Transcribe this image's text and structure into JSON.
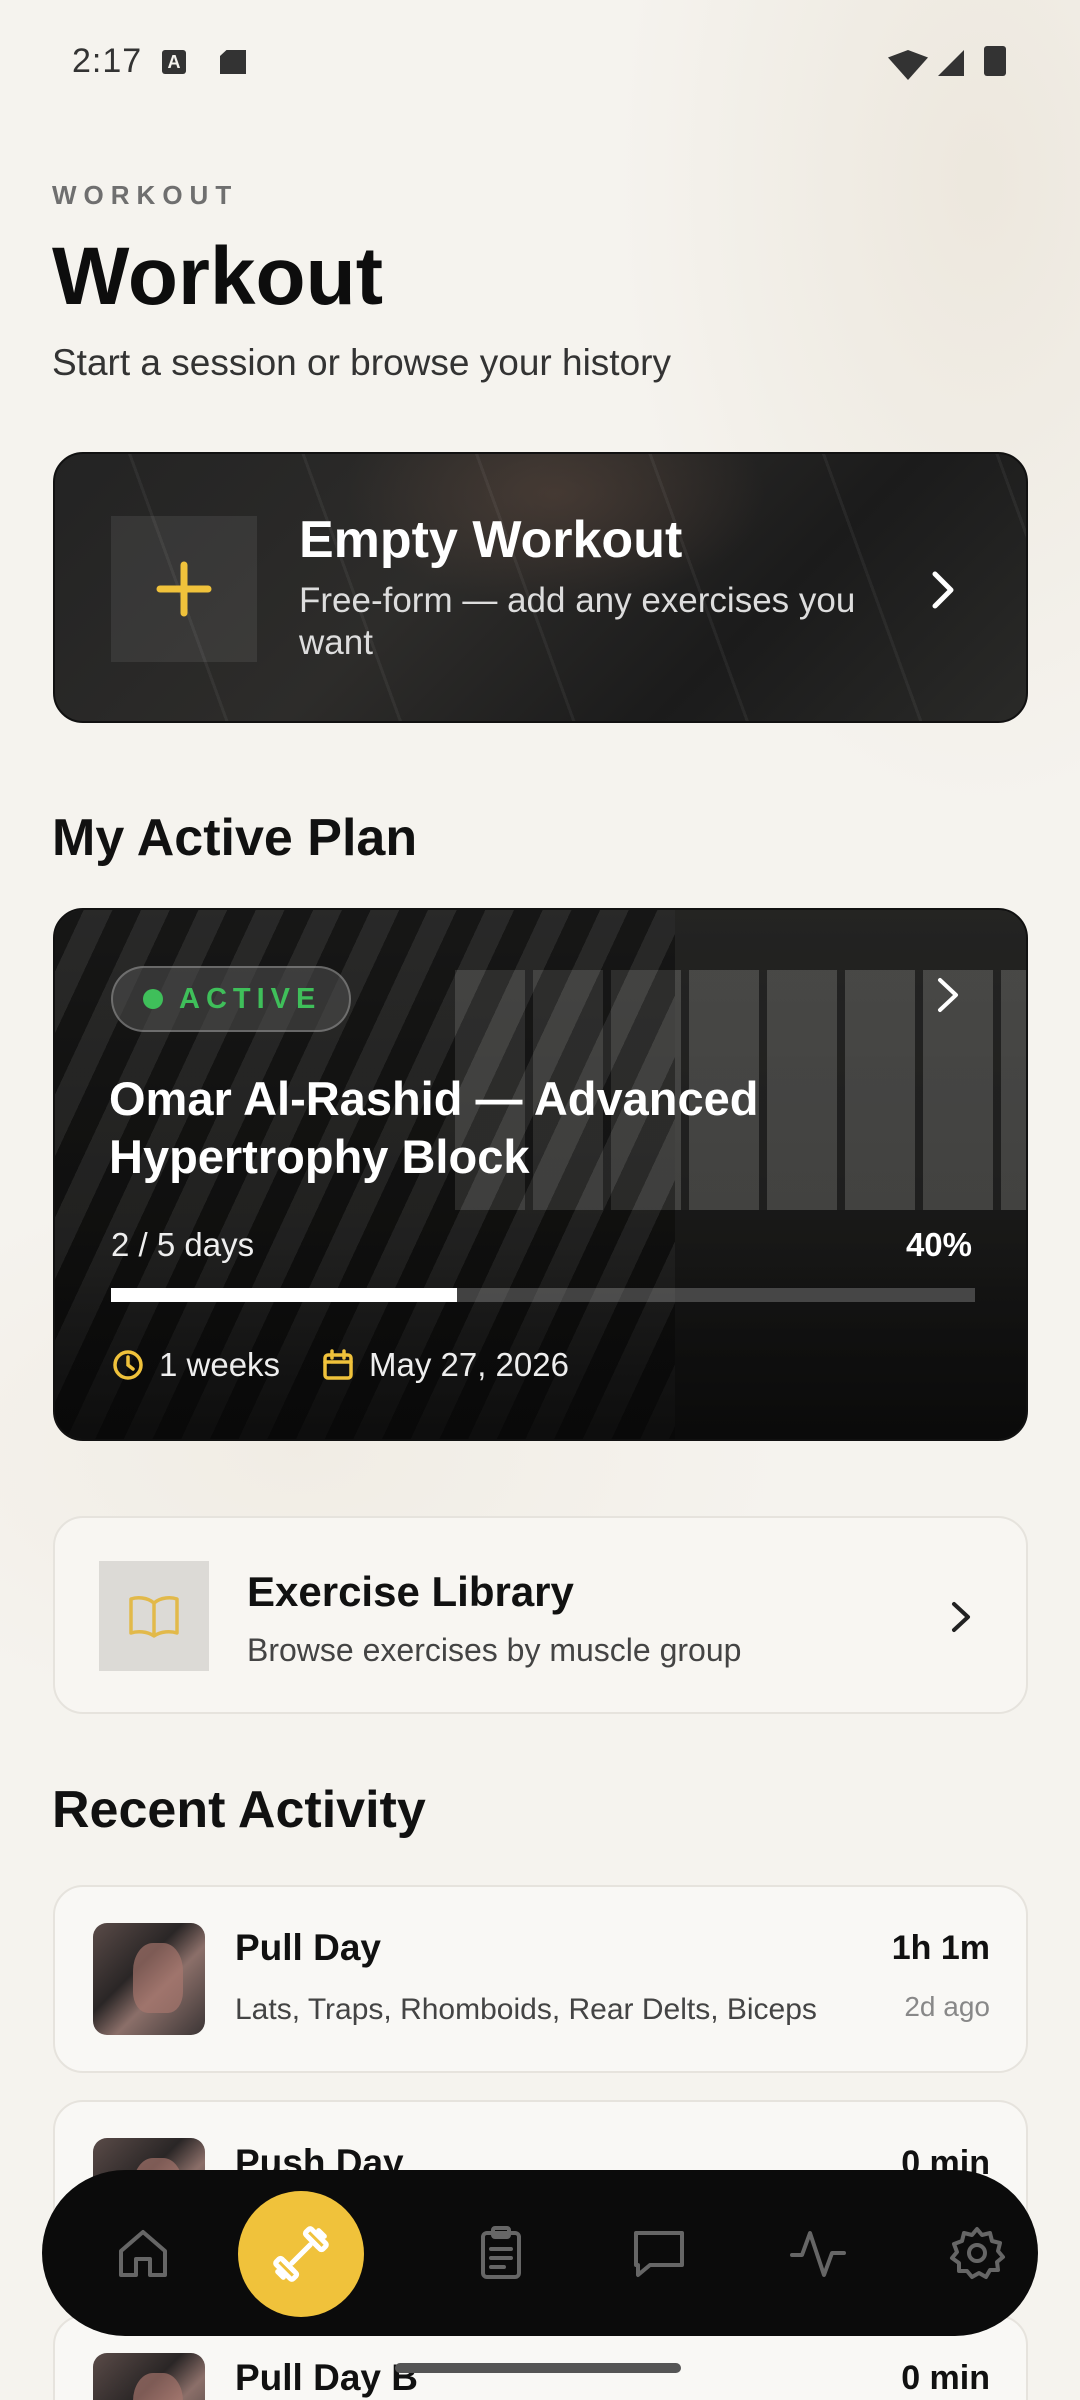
{
  "status_bar": {
    "time": "2:17",
    "a_icon_letter": "A"
  },
  "header": {
    "eyebrow": "WORKOUT",
    "title": "Workout",
    "subtitle": "Start a session or browse your history"
  },
  "empty_workout": {
    "title": "Empty Workout",
    "description": "Free-form — add any exercises you want",
    "icon": "plus-icon"
  },
  "active_plan": {
    "section_title": "My Active Plan",
    "badge": "ACTIVE",
    "title": "Omar Al-Rashid — Advanced Hypertrophy Block",
    "days": "2 / 5 days",
    "percent": "40%",
    "progress_fraction": 0.4,
    "duration": "1 weeks",
    "date": "May 27, 2026"
  },
  "library": {
    "title": "Exercise Library",
    "description": "Browse exercises by muscle group",
    "icon": "book-icon"
  },
  "recent": {
    "section_title": "Recent Activity",
    "items": [
      {
        "title": "Pull Day",
        "muscles": "Lats, Traps, Rhomboids, Rear Delts, Biceps",
        "duration": "1h 1m",
        "ago": "2d ago"
      },
      {
        "title": "Push Day",
        "muscles": "",
        "duration": "0 min",
        "ago": ""
      },
      {
        "title": "Pull Day B",
        "muscles": "",
        "duration": "0 min",
        "ago": ""
      }
    ]
  },
  "nav": {
    "items": [
      "home-icon",
      "dumbbell-icon",
      "clipboard-icon",
      "chat-icon",
      "activity-icon",
      "settings-icon"
    ],
    "active": "dumbbell-icon"
  },
  "colors": {
    "accent": "#f0c23b",
    "active_green": "#3fbf5a",
    "background": "#f5f3ee",
    "nav_background": "#0b0b0b"
  }
}
